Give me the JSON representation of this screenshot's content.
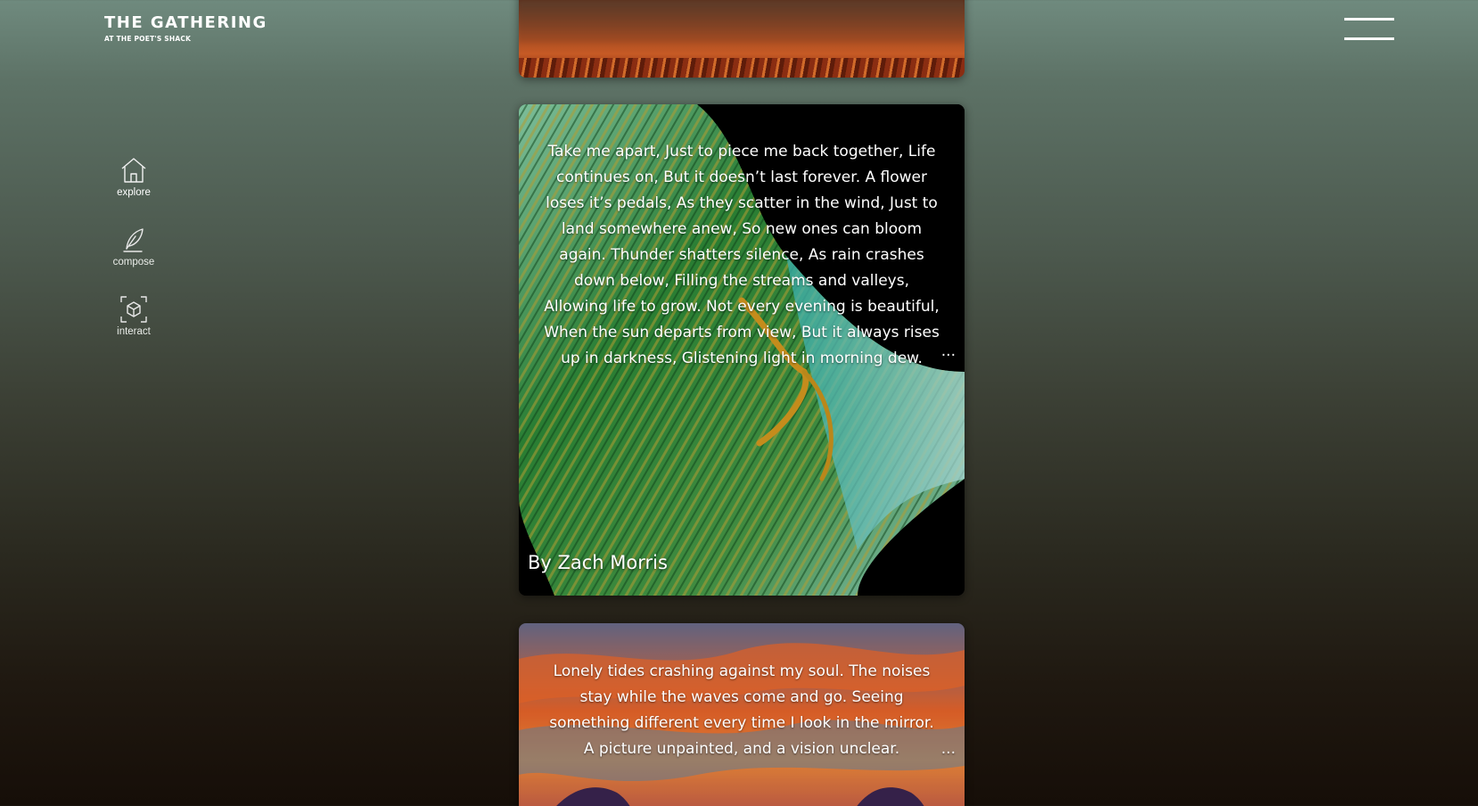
{
  "brand": {
    "title": "THE GATHERING",
    "subtitle": "AT THE POET'S SHACK"
  },
  "header": {
    "menu_icon": "hamburger-menu-icon"
  },
  "sidenav": {
    "items": [
      {
        "label": "explore",
        "icon": "home-icon",
        "active": true
      },
      {
        "label": "compose",
        "icon": "feather-quill-icon",
        "active": false
      },
      {
        "label": "interact",
        "icon": "cube-ar-icon",
        "active": false
      }
    ]
  },
  "feed": {
    "posts": [
      {
        "poem": "Take me apart, Just to piece me back together, Life continues on, But it doesn’t last forever. A flower loses it’s pedals, As they scatter in the wind, Just to land somewhere anew, So new ones can bloom again. Thunder shatters silence, As rain crashes down below, Filling the streams and valleys, Allowing life to grow. Not every evening is beautiful, When the sun departs from view, But it always rises up in darkness, Glistening light in morning dew.",
        "more": "...",
        "author": "By Zach Morris"
      },
      {
        "poem": "Lonely tides crashing against my soul. The noises stay while the waves come and go. Seeing something different every time I look in the mirror. A picture unpainted, and a vision unclear.",
        "more": "..."
      }
    ]
  },
  "colors": {
    "bg_top": "#6f8a7e",
    "bg_bottom": "#160e08",
    "text": "#ffffff"
  }
}
